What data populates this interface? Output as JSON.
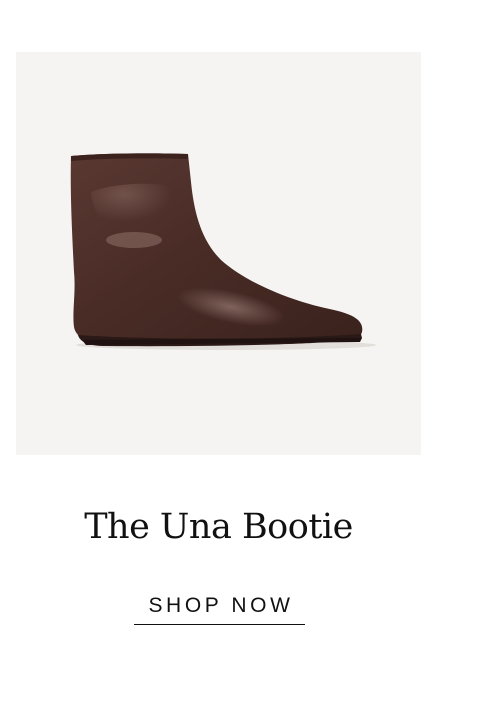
{
  "product": {
    "title": "The Una Bootie",
    "image_subject": "boot-image",
    "colors": {
      "image_background": "#f5f4f2",
      "leather": "#4b2e28",
      "text": "#111111"
    }
  },
  "cta": {
    "label": "SHOP NOW"
  }
}
